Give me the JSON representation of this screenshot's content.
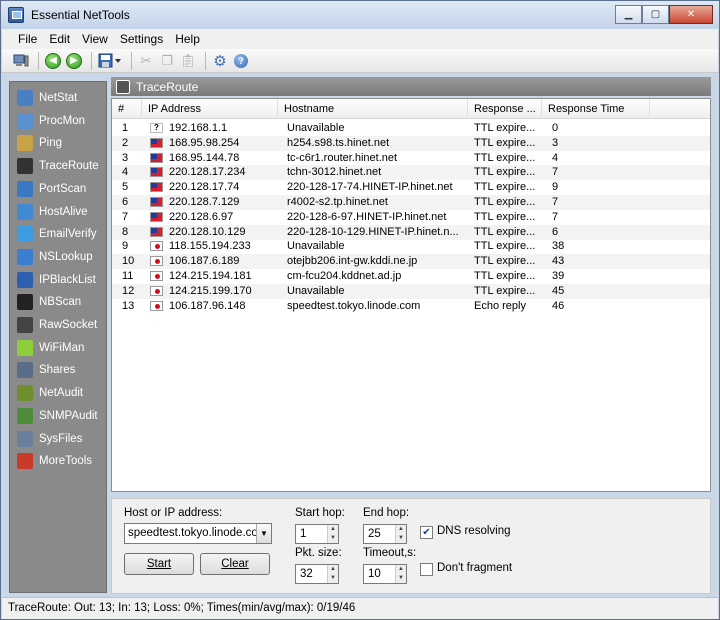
{
  "window": {
    "title": "Essential NetTools"
  },
  "menu": [
    "File",
    "Edit",
    "View",
    "Settings",
    "Help"
  ],
  "toolbar": {
    "icons": [
      "computer-icon",
      "back-icon",
      "forward-icon",
      "save-icon",
      "cut-icon",
      "copy-icon",
      "paste-icon",
      "settings-icon",
      "help-icon"
    ]
  },
  "sidebar": {
    "items": [
      {
        "label": "NetStat",
        "color": "#4a7fc1"
      },
      {
        "label": "ProcMon",
        "color": "#5a8fd0"
      },
      {
        "label": "Ping",
        "color": "#c9a34a"
      },
      {
        "label": "TraceRoute",
        "color": "#333333"
      },
      {
        "label": "PortScan",
        "color": "#3b78c4"
      },
      {
        "label": "HostAlive",
        "color": "#3f8ad1"
      },
      {
        "label": "EmailVerify",
        "color": "#3d9be0"
      },
      {
        "label": "NSLookup",
        "color": "#3c7fd0"
      },
      {
        "label": "IPBlackList",
        "color": "#2d5fb0"
      },
      {
        "label": "NBScan",
        "color": "#222222"
      },
      {
        "label": "RawSocket",
        "color": "#444444"
      },
      {
        "label": "WiFiMan",
        "color": "#8ccf3a"
      },
      {
        "label": "Shares",
        "color": "#5a6e8c"
      },
      {
        "label": "NetAudit",
        "color": "#6f8f2f"
      },
      {
        "label": "SNMPAudit",
        "color": "#4d8c3a"
      },
      {
        "label": "SysFiles",
        "color": "#6a7f99"
      },
      {
        "label": "MoreTools",
        "color": "#c83a2a"
      }
    ]
  },
  "panel": {
    "title": "TraceRoute"
  },
  "table": {
    "headers": [
      "#",
      "IP Address",
      "Hostname",
      "Response ...",
      "Response Time"
    ],
    "rows": [
      {
        "n": "1",
        "flag": "unk",
        "ip": "192.168.1.1",
        "host": "Unavailable",
        "resp": "TTL expire...",
        "time": "0"
      },
      {
        "n": "2",
        "flag": "tw",
        "ip": "168.95.98.254",
        "host": "h254.s98.ts.hinet.net",
        "resp": "TTL expire...",
        "time": "3"
      },
      {
        "n": "3",
        "flag": "tw",
        "ip": "168.95.144.78",
        "host": "tc-c6r1.router.hinet.net",
        "resp": "TTL expire...",
        "time": "4"
      },
      {
        "n": "4",
        "flag": "tw",
        "ip": "220.128.17.234",
        "host": "tchn-3012.hinet.net",
        "resp": "TTL expire...",
        "time": "7"
      },
      {
        "n": "5",
        "flag": "tw",
        "ip": "220.128.17.74",
        "host": "220-128-17-74.HINET-IP.hinet.net",
        "resp": "TTL expire...",
        "time": "9"
      },
      {
        "n": "6",
        "flag": "tw",
        "ip": "220.128.7.129",
        "host": "r4002-s2.tp.hinet.net",
        "resp": "TTL expire...",
        "time": "7"
      },
      {
        "n": "7",
        "flag": "tw",
        "ip": "220.128.6.97",
        "host": "220-128-6-97.HINET-IP.hinet.net",
        "resp": "TTL expire...",
        "time": "7"
      },
      {
        "n": "8",
        "flag": "tw",
        "ip": "220.128.10.129",
        "host": "220-128-10-129.HINET-IP.hinet.n...",
        "resp": "TTL expire...",
        "time": "6"
      },
      {
        "n": "9",
        "flag": "jp",
        "ip": "118.155.194.233",
        "host": "Unavailable",
        "resp": "TTL expire...",
        "time": "38"
      },
      {
        "n": "10",
        "flag": "jp",
        "ip": "106.187.6.189",
        "host": "otejbb206.int-gw.kddi.ne.jp",
        "resp": "TTL expire...",
        "time": "43"
      },
      {
        "n": "11",
        "flag": "jp",
        "ip": "124.215.194.181",
        "host": "cm-fcu204.kddnet.ad.jp",
        "resp": "TTL expire...",
        "time": "39"
      },
      {
        "n": "12",
        "flag": "jp",
        "ip": "124.215.199.170",
        "host": "Unavailable",
        "resp": "TTL expire...",
        "time": "45"
      },
      {
        "n": "13",
        "flag": "jp",
        "ip": "106.187.96.148",
        "host": "speedtest.tokyo.linode.com",
        "resp": "Echo reply",
        "time": "46"
      }
    ]
  },
  "form": {
    "host_label": "Host or IP address:",
    "host_value": "speedtest.tokyo.linode.com",
    "start_button": "Start",
    "clear_button": "Clear",
    "start_hop_label": "Start hop:",
    "start_hop_value": "1",
    "end_hop_label": "End hop:",
    "end_hop_value": "25",
    "pkt_size_label": "Pkt. size:",
    "pkt_size_value": "32",
    "timeout_label": "Timeout,s:",
    "timeout_value": "10",
    "dns_label": "DNS resolving",
    "dns_checked": true,
    "frag_label": "Don't fragment",
    "frag_checked": false
  },
  "status": {
    "text": "TraceRoute: Out: 13; In: 13; Loss: 0%; Times(min/avg/max): 0/19/46"
  }
}
